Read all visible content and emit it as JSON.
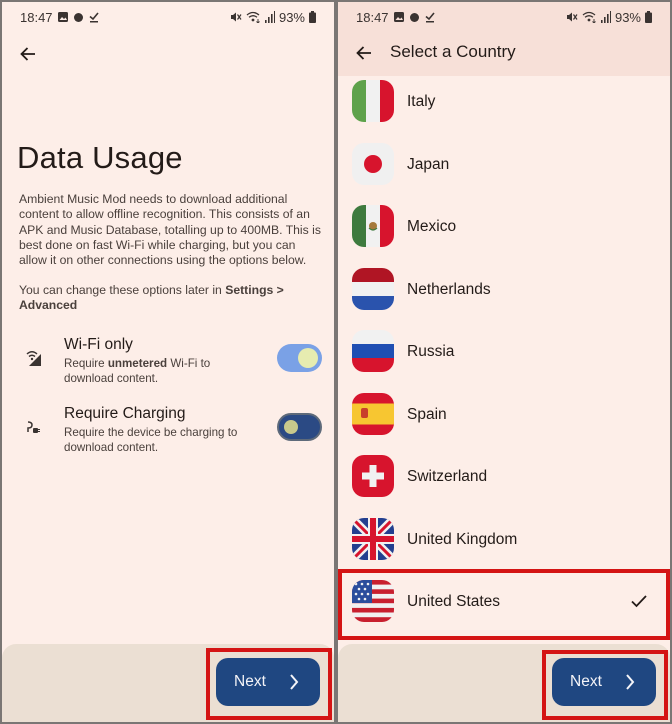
{
  "status_bar": {
    "time": "18:47",
    "battery": "93%",
    "left_icons": [
      "gallery-icon",
      "notification-dot-icon",
      "download-done-icon"
    ],
    "right_icons": [
      "mute-icon",
      "wifi-icon",
      "signal-icon",
      "battery-icon"
    ]
  },
  "left_screen": {
    "title": "Data Usage",
    "description": "Ambient Music Mod needs to download additional content to allow offline recognition. This consists of an APK and Music Database, totalling up to 400MB. This is best done on fast Wi-Fi while charging, but you can allow it on other connections using the options below.",
    "note_prefix": "You can change these options later in ",
    "note_bold": "Settings > Advanced",
    "settings": [
      {
        "title": "Wi-Fi only",
        "sub_prefix": "Require ",
        "sub_bold": "unmetered",
        "sub_suffix": " Wi-Fi to download content.",
        "icon": "wifi-restricted-icon",
        "enabled": true
      },
      {
        "title": "Require Charging",
        "sub_prefix": "Require the device be charging to download content.",
        "sub_bold": "",
        "sub_suffix": "",
        "icon": "charging-plug-icon",
        "enabled": false
      }
    ],
    "next_label": "Next"
  },
  "right_screen": {
    "title": "Select a Country",
    "countries": [
      {
        "name": "Italy",
        "selected": false
      },
      {
        "name": "Japan",
        "selected": false
      },
      {
        "name": "Mexico",
        "selected": false
      },
      {
        "name": "Netherlands",
        "selected": false
      },
      {
        "name": "Russia",
        "selected": false
      },
      {
        "name": "Spain",
        "selected": false
      },
      {
        "name": "Switzerland",
        "selected": false
      },
      {
        "name": "United Kingdom",
        "selected": false
      },
      {
        "name": "United States",
        "selected": true
      }
    ],
    "next_label": "Next"
  },
  "colors": {
    "background": "#fdeee8",
    "app_bar": "#f7e0d8",
    "bottom_bar": "#ebdfd3",
    "primary_button": "#1f4781",
    "toggle_on": "#7aa1e6",
    "toggle_off": "#2b4a84",
    "highlight": "#d41414"
  }
}
